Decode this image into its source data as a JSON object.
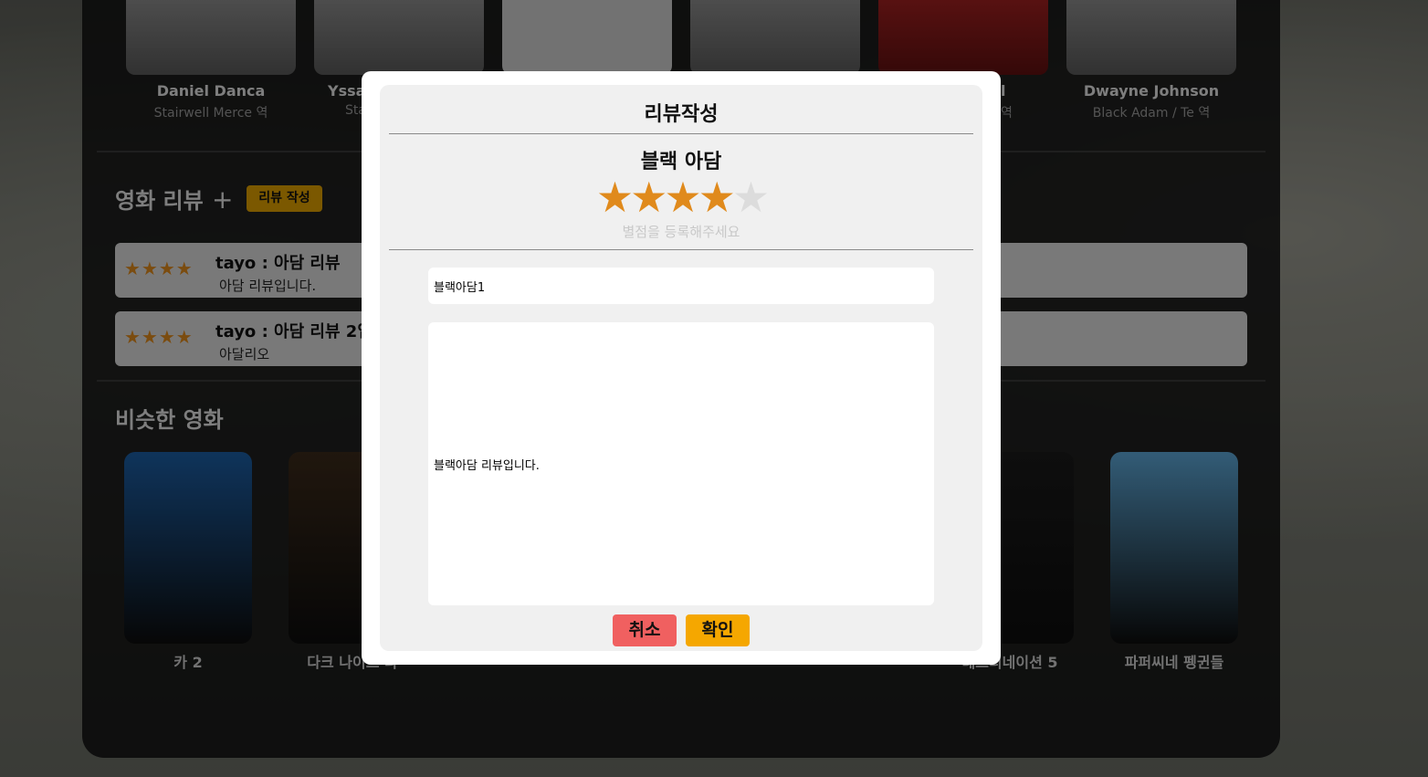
{
  "cast": [
    {
      "name": "Daniel Danca",
      "role": "Stairwell Merce 역"
    },
    {
      "name": "Yssa",
      "role": "Sta"
    },
    {
      "name": "",
      "role": ""
    },
    {
      "name": "",
      "role": ""
    },
    {
      "name": "l",
      "role": "역"
    },
    {
      "name": "Dwayne Johnson",
      "role": "Black Adam / Te 역"
    }
  ],
  "reviews_section": {
    "title": "영화 리뷰",
    "plus": "+",
    "write_button": "리뷰 작성",
    "items": [
      {
        "stars": "★★★★",
        "head": "tayo : 아담 리뷰",
        "body": "아담 리뷰입니다."
      },
      {
        "stars": "★★★★",
        "head": "tayo : 아담 리뷰 2입",
        "body": "아달리오"
      }
    ]
  },
  "similar_section": {
    "title": "비슷한 영화",
    "movies": [
      {
        "title": "카 2",
        "color": "#1c5fa6"
      },
      {
        "title": "다크 나이트 라",
        "color": "#3b2a1a"
      },
      {
        "title": "",
        "color": "#222222"
      },
      {
        "title": "",
        "color": "#222222"
      },
      {
        "title": "",
        "color": "#222222"
      },
      {
        "title": "데스티네이션 5",
        "color": "#1a1a1a"
      },
      {
        "title": "파퍼씨네 펭귄들",
        "color": "#5da8d8"
      }
    ]
  },
  "modal": {
    "title": "리뷰작성",
    "movie_title": "블랙 아담",
    "rating": 4,
    "max_rating": 5,
    "star_filled_color": "#e08a1c",
    "star_empty_color": "#dcdcdc",
    "rating_hint": "별점을 등록해주세요",
    "title_input_value": "블랙아담1",
    "content_value": "블랙아담 리뷰입니다.",
    "cancel_label": "취소",
    "confirm_label": "확인"
  }
}
